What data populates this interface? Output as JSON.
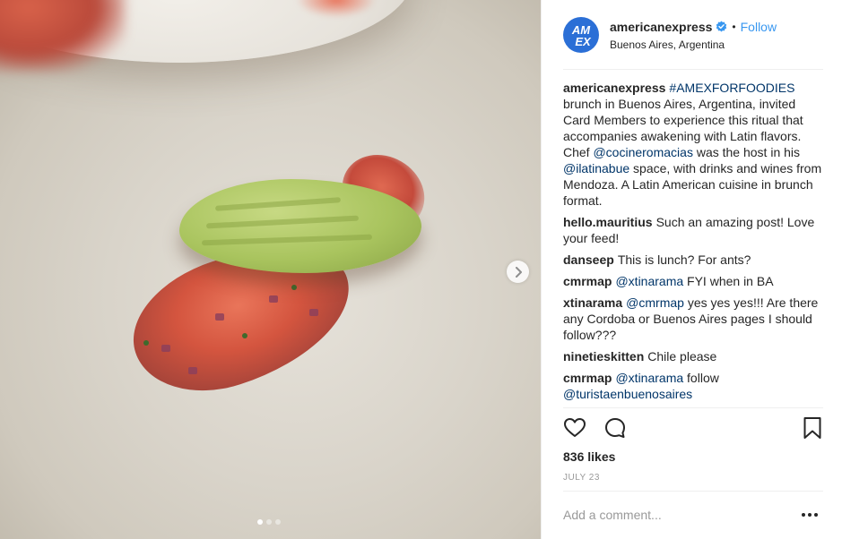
{
  "post": {
    "username": "americanexpress",
    "location": "Buenos Aires, Argentina",
    "follow_label": "Follow",
    "separator": "•",
    "avatar_text": "AM EX",
    "avatar_color": "#2b6fd6",
    "verified_color": "#3897f0"
  },
  "caption": {
    "author": "americanexpress",
    "hashtag": "#AMEXFORFOODIES",
    "text1": " brunch in Buenos Aires, Argentina, invited Card Members to experience this ritual that accompanies awakening with Latin flavors. Chef ",
    "mention1": "@cocineromacias",
    "text2": " was the host in his ",
    "mention2": "@ilatinabue",
    "text3": " space, with drinks and wines from Mendoza. A Latin American cuisine in brunch format."
  },
  "comments": [
    {
      "author": "hello.mauritius",
      "text": "Such an amazing post! Love your feed!"
    },
    {
      "author": "danseep",
      "text": "This is lunch? For ants?"
    },
    {
      "author": "cmrmap",
      "mention": "@xtinarama",
      "text": " FYI when in BA"
    },
    {
      "author": "xtinarama",
      "mention": "@cmrmap",
      "text": " yes yes yes!!! Are there any Cordoba or Buenos Aires pages I should follow???"
    },
    {
      "author": "ninetieskitten",
      "text": "Chile please"
    },
    {
      "author": "cmrmap",
      "mention": "@xtinarama",
      "text": " follow ",
      "mention2": "@turistaenbuenosaires"
    }
  ],
  "engagement": {
    "likes": "836 likes",
    "date": "JULY 23"
  },
  "composer": {
    "placeholder": "Add a comment..."
  },
  "carousel": {
    "current": 1,
    "total": 3
  },
  "icons": {
    "like": "heart-icon",
    "comment": "speech-bubble-icon",
    "save": "bookmark-icon",
    "next": "chevron-right-icon",
    "more": "ellipsis-icon",
    "verified": "verified-badge-icon"
  },
  "colors": {
    "link": "#003569",
    "follow": "#3897f0",
    "muted": "#999999"
  }
}
